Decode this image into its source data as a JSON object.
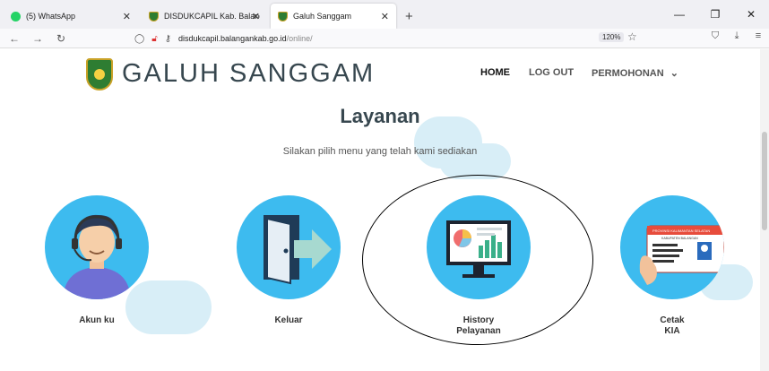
{
  "browser": {
    "tabs": [
      {
        "title": "(5) WhatsApp",
        "icon": "whatsapp-icon"
      },
      {
        "title": "DISDUKCAPIL Kab. Balangan",
        "icon": "shield-logo-icon"
      },
      {
        "title": "Galuh Sanggam",
        "icon": "shield-logo-icon",
        "active": true
      }
    ],
    "new_tab": "+",
    "url_domain": "disdukcapil.balangankab.go.id",
    "url_path": "/online/",
    "zoom": "120%"
  },
  "header": {
    "brand": "GALUH SANGGAM",
    "menu": {
      "home": "HOME",
      "logout": "LOG OUT",
      "permohonan": "PERMOHONAN"
    }
  },
  "main": {
    "title": "Layanan",
    "subtitle": "Silakan pilih menu yang telah kami sediakan",
    "cards": [
      {
        "label_1": "Akun ku",
        "label_2": "",
        "icon": "user-headset-icon"
      },
      {
        "label_1": "Keluar",
        "label_2": "",
        "icon": "exit-door-icon"
      },
      {
        "label_1": "History",
        "label_2": "Pelayanan",
        "icon": "monitor-chart-icon"
      },
      {
        "label_1": "Cetak",
        "label_2": "KIA",
        "icon": "id-card-icon"
      }
    ],
    "id_card_text": {
      "line1": "PROVINSI KALIMANTAN SELATAN",
      "line2": "KABUPATEN BALANGAN"
    }
  },
  "colors": {
    "accent": "#3dbbef",
    "brand_text": "#37474f",
    "cloud": "#d8eef7"
  }
}
